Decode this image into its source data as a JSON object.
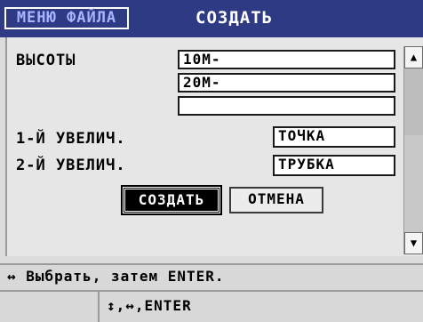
{
  "header": {
    "menu_tab": "МЕНЮ ФАЙЛА",
    "title": "СОЗДАТЬ"
  },
  "form": {
    "heights_label": "ВЫСОТЫ",
    "heights_values": [
      "10M-",
      "20M-",
      ""
    ],
    "gain1_label": "1-Й УВЕЛИЧ.",
    "gain1_value": "ТОЧКА",
    "gain2_label": "2-Й УВЕЛИЧ.",
    "gain2_value": "ТРУБКА"
  },
  "buttons": {
    "create": "СОЗДАТЬ",
    "cancel": "ОТМЕНА"
  },
  "scrollbar": {
    "up_icon": "arrow-up",
    "down_icon": "arrow-down"
  },
  "status": {
    "text": "↔ Выбрать, затем ENTER."
  },
  "hint": {
    "text": "↕,↔,ENTER"
  },
  "colors": {
    "titlebar": "#2f3a84",
    "menu_tab_text": "#a7b4ff"
  }
}
